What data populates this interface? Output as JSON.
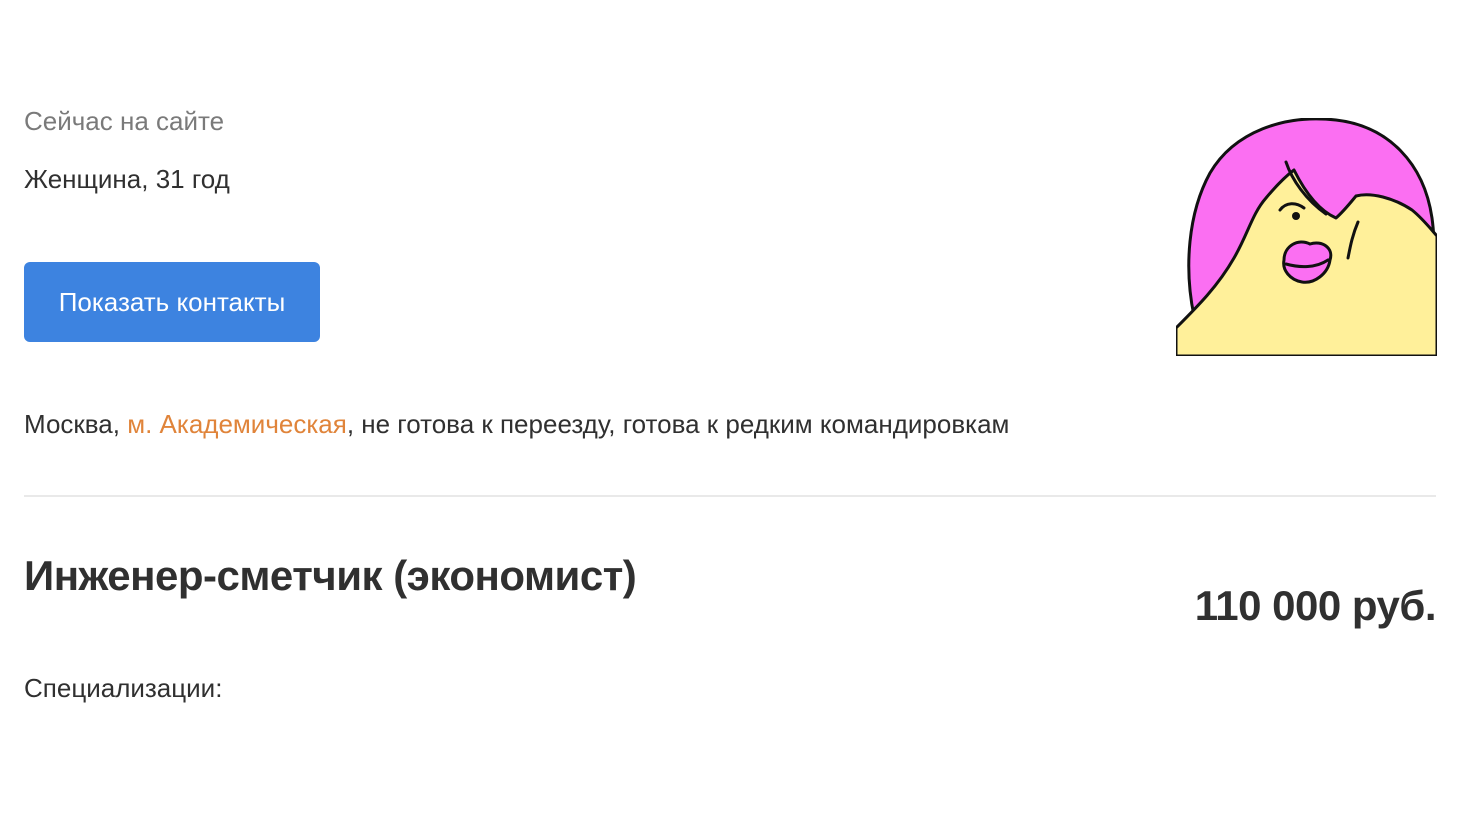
{
  "profile": {
    "online_status": "Сейчас на сайте",
    "gender_age": "Женщина, 31 год",
    "show_contacts_label": "Показать контакты",
    "avatar_icon": "cartoon-woman-avatar-icon"
  },
  "location": {
    "city": "Москва",
    "separator1": ", ",
    "metro": "м. Академическая",
    "relocation": ", не готова к переезду, готова к редким командировкам"
  },
  "resume": {
    "title": "Инженер-сметчик (экономист)",
    "salary": "110 000 руб.",
    "specializations_label": "Специализации:"
  },
  "colors": {
    "button_bg": "#3d83e0",
    "metro_link": "#e0843a",
    "avatar_hair": "#fb6ff2",
    "avatar_face": "#fff09a",
    "outline": "#111111"
  }
}
